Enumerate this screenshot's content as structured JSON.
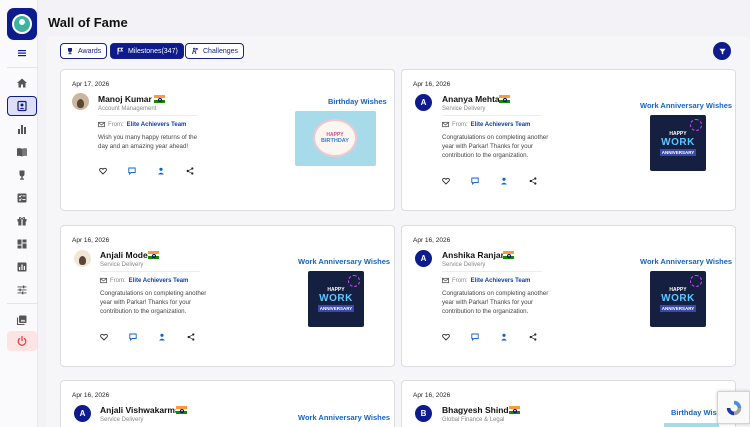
{
  "page": {
    "title": "Wall of Fame"
  },
  "tabs": [
    {
      "label": "Awards",
      "icon": "trophy-icon"
    },
    {
      "label": "Milestones(347)",
      "icon": "flag-icon"
    },
    {
      "label": "Challenges",
      "icon": "challenge-icon"
    }
  ],
  "sidebar": {
    "items": [
      "hamburger-icon",
      "home-icon",
      "wall-icon",
      "bar-chart-icon",
      "book-icon",
      "trophy-icon",
      "list-check-icon",
      "gift-icon",
      "dashboard-icon",
      "report-icon",
      "sliders-icon",
      "album-icon",
      "power-icon"
    ],
    "active": "wall-icon"
  },
  "cards": [
    {
      "date": "Apr 17, 2026",
      "initial": "",
      "name": "Manoj Kumar",
      "dept": "Account Management",
      "from_label": "From:",
      "team": "Elite Achievers Team",
      "message": "Wish you many happy returns of the day and an amazing year ahead!",
      "type": "Birthday Wishes",
      "image": "birthday",
      "image_text": [
        "HAPPY",
        "BIRTHDAY"
      ]
    },
    {
      "date": "Apr 16, 2026",
      "initial": "A",
      "name": "Ananya Mehta",
      "dept": "Service Delivery",
      "from_label": "From:",
      "team": "Elite Achievers Team",
      "message": "Congratulations on completing another year with Parkar! Thanks for your contribution to the organization.",
      "type": "Work Anniversary Wishes",
      "image": "work",
      "image_text": [
        "HAPPY",
        "WORK",
        "ANNIVERSARY"
      ]
    },
    {
      "date": "Apr 16, 2026",
      "initial": "",
      "name": "Anjali Mode",
      "dept": "Service Delivery",
      "from_label": "From:",
      "team": "Elite Achievers Team",
      "message": "Congratulations on completing another year with Parkar! Thanks for your contribution to the organization.",
      "type": "Work Anniversary Wishes",
      "image": "work",
      "image_text": [
        "HAPPY",
        "WORK",
        "ANNIVERSARY"
      ]
    },
    {
      "date": "Apr 16, 2026",
      "initial": "A",
      "name": "Anshika Ranjan",
      "dept": "Service Delivery",
      "from_label": "From:",
      "team": "Elite Achievers Team",
      "message": "Congratulations on completing another year with Parkar! Thanks for your contribution to the organization.",
      "type": "Work Anniversary Wishes",
      "image": "work",
      "image_text": [
        "HAPPY",
        "WORK",
        "ANNIVERSARY"
      ]
    },
    {
      "date": "Apr 16, 2026",
      "initial": "A",
      "name": "Anjali Vishwakarma",
      "dept": "Service Delivery",
      "type": "Work Anniversary Wishes"
    },
    {
      "date": "Apr 16, 2026",
      "initial": "B",
      "name": "Bhagyesh Shinde",
      "dept": "Global Finance & Legal",
      "type": "Birthday Wishes"
    }
  ],
  "colors": {
    "primary": "#0d1b8c",
    "link": "#1565c0",
    "power": "#e53935"
  }
}
